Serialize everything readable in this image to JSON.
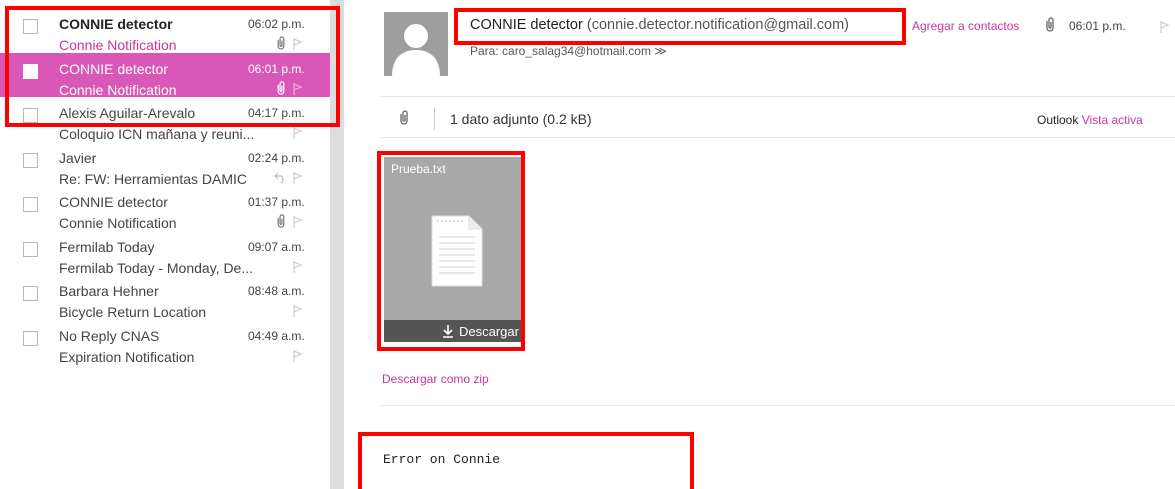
{
  "message_list": [
    {
      "sender": "CONNIE detector",
      "time": "06:02 p.m.",
      "subject": "Connie Notification",
      "unread": true,
      "selected": false,
      "attachment": true,
      "reply": false,
      "subject_pink": true
    },
    {
      "sender": "CONNIE detector",
      "time": "06:01 p.m.",
      "subject": "Connie Notification",
      "unread": false,
      "selected": true,
      "attachment": true,
      "reply": false,
      "subject_pink": false
    },
    {
      "sender": "Alexis Aguilar-Arevalo",
      "time": "04:17 p.m.",
      "subject": "Coloquio ICN mañana y reuni...",
      "unread": false,
      "selected": false,
      "attachment": false,
      "reply": false,
      "subject_pink": false
    },
    {
      "sender": "Javier",
      "time": "02:24 p.m.",
      "subject": "Re: FW: Herramientas DAMIC",
      "unread": false,
      "selected": false,
      "attachment": false,
      "reply": true,
      "subject_pink": false
    },
    {
      "sender": "CONNIE detector",
      "time": "01:37 p.m.",
      "subject": "Connie Notification",
      "unread": false,
      "selected": false,
      "attachment": true,
      "reply": false,
      "subject_pink": false
    },
    {
      "sender": "Fermilab Today",
      "time": "09:07 a.m.",
      "subject": "Fermilab Today - Monday, De...",
      "unread": false,
      "selected": false,
      "attachment": false,
      "reply": false,
      "subject_pink": false
    },
    {
      "sender": "Barbara Hehner",
      "time": "08:48 a.m.",
      "subject": "Bicycle Return Location",
      "unread": false,
      "selected": false,
      "attachment": false,
      "reply": false,
      "subject_pink": false
    },
    {
      "sender": "No Reply CNAS",
      "time": "04:49 a.m.",
      "subject": "Expiration Notification",
      "unread": false,
      "selected": false,
      "attachment": false,
      "reply": false,
      "subject_pink": false
    }
  ],
  "reading_pane": {
    "from_name": "CONNIE detector",
    "from_email": "(connie.detector.notification@gmail.com)",
    "add_contact": "Agregar a contactos",
    "time": "06:01 p.m.",
    "to_line": "Para: caro_salag34@hotmail.com ≫",
    "attachment_count": "1 dato adjunto (0.2 kB)",
    "view_label": "Outlook",
    "view_active": "Vista activa",
    "attachment": {
      "name": "Prueba.txt",
      "download_label": "Descargar"
    },
    "zip_link": "Descargar como zip",
    "body": "Error on Connie"
  },
  "colors": {
    "accent": "#d957b6",
    "link": "#c8369f",
    "highlight": "#ff0000"
  },
  "icons": [
    "paperclip-icon",
    "reply-icon",
    "flag-icon",
    "avatar-placeholder-icon",
    "document-icon",
    "download-icon"
  ]
}
